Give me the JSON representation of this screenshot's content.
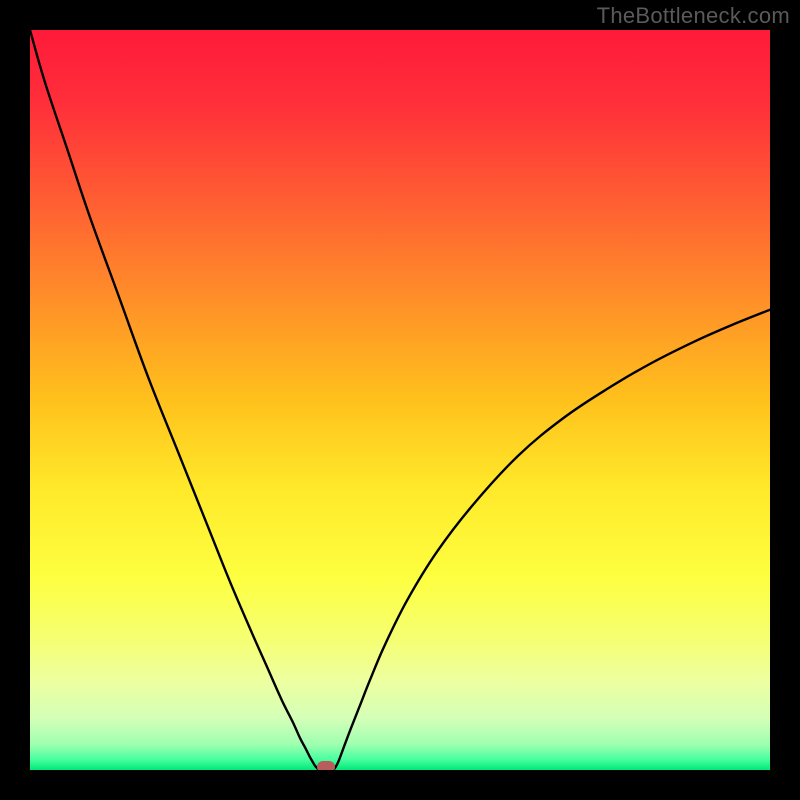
{
  "watermark": "TheBottleneck.com",
  "chart_data": {
    "type": "line",
    "title": "",
    "xlabel": "",
    "ylabel": "",
    "xlim": [
      0,
      100
    ],
    "ylim": [
      0,
      100
    ],
    "gradient_stops": [
      {
        "offset": 0.0,
        "color": "#ff1a3a"
      },
      {
        "offset": 0.1,
        "color": "#ff2f3a"
      },
      {
        "offset": 0.22,
        "color": "#ff5a33"
      },
      {
        "offset": 0.35,
        "color": "#ff8a2a"
      },
      {
        "offset": 0.5,
        "color": "#ffc11c"
      },
      {
        "offset": 0.62,
        "color": "#ffe92a"
      },
      {
        "offset": 0.74,
        "color": "#fdff40"
      },
      {
        "offset": 0.82,
        "color": "#f6ff70"
      },
      {
        "offset": 0.88,
        "color": "#edffa0"
      },
      {
        "offset": 0.93,
        "color": "#d4ffb8"
      },
      {
        "offset": 0.965,
        "color": "#9fffb0"
      },
      {
        "offset": 0.985,
        "color": "#4cffa0"
      },
      {
        "offset": 1.0,
        "color": "#00e878"
      }
    ],
    "series": [
      {
        "name": "left-branch",
        "x": [
          0,
          2,
          5,
          8,
          12,
          16,
          20,
          24,
          27,
          30,
          32,
          34,
          35.5,
          36.5,
          37.3,
          37.8,
          38.2,
          38.5,
          38.8,
          39.0
        ],
        "y": [
          100,
          93,
          84,
          75,
          64,
          53,
          43,
          33,
          25.5,
          18.5,
          14,
          9.5,
          6.5,
          4.3,
          2.8,
          1.8,
          1.1,
          0.6,
          0.25,
          0.05
        ]
      },
      {
        "name": "right-branch",
        "x": [
          41.0,
          41.3,
          41.7,
          42.3,
          43.2,
          44.5,
          46,
          48,
          51,
          55,
          60,
          66,
          72,
          78,
          84,
          90,
          95,
          100
        ],
        "y": [
          0.05,
          0.4,
          1.2,
          2.8,
          5.2,
          8.5,
          12.3,
          17.0,
          23.0,
          29.5,
          36.0,
          42.5,
          47.5,
          51.5,
          55.0,
          58.0,
          60.2,
          62.2
        ]
      }
    ],
    "marker": {
      "x": 40.0,
      "y": 0.0,
      "color": "#b85c5c"
    },
    "flat_segment": {
      "x0": 39.0,
      "x1": 41.0,
      "y": 0.0
    }
  }
}
